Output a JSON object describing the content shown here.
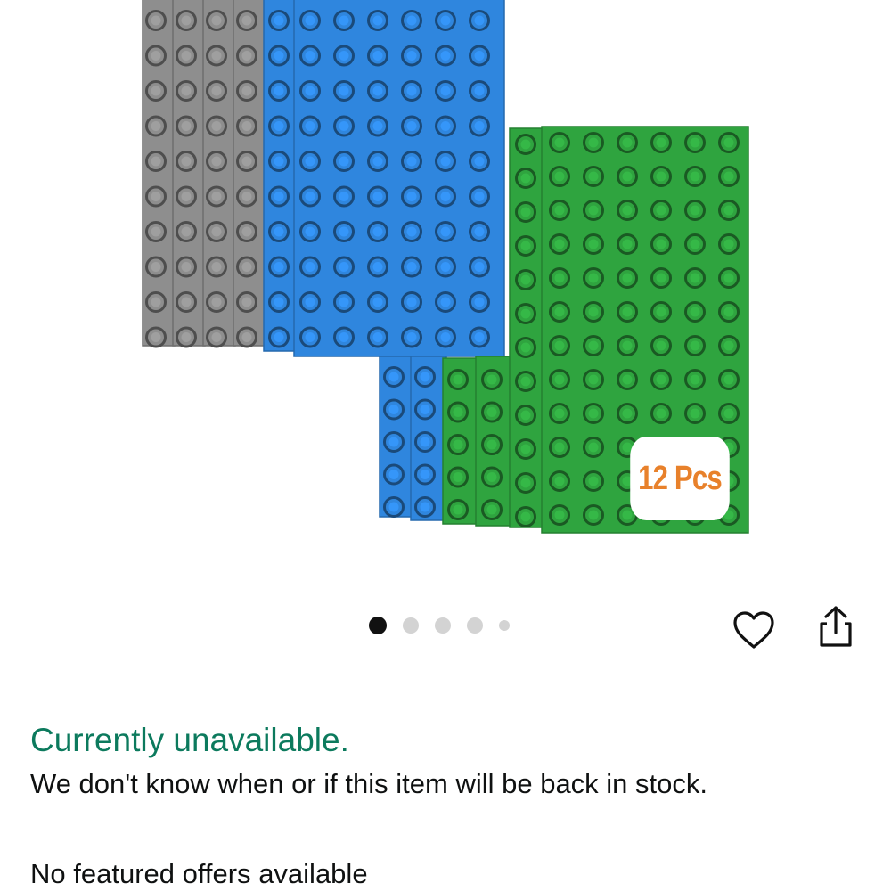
{
  "product": {
    "badge_text": "12 Pcs",
    "plate_colors": {
      "gray": "#8e8e8e",
      "blue": "#2f86de",
      "green": "#2fa43f"
    },
    "carousel": {
      "total": 5,
      "active_index": 0
    }
  },
  "actions": {
    "wishlist_icon": "heart-icon",
    "share_icon": "share-icon"
  },
  "availability": {
    "status": "Currently unavailable.",
    "message": "We don't know when or if this item will be back in stock.",
    "accent_color": "#0c7a5d"
  },
  "offers": {
    "label": "No featured offers available"
  }
}
